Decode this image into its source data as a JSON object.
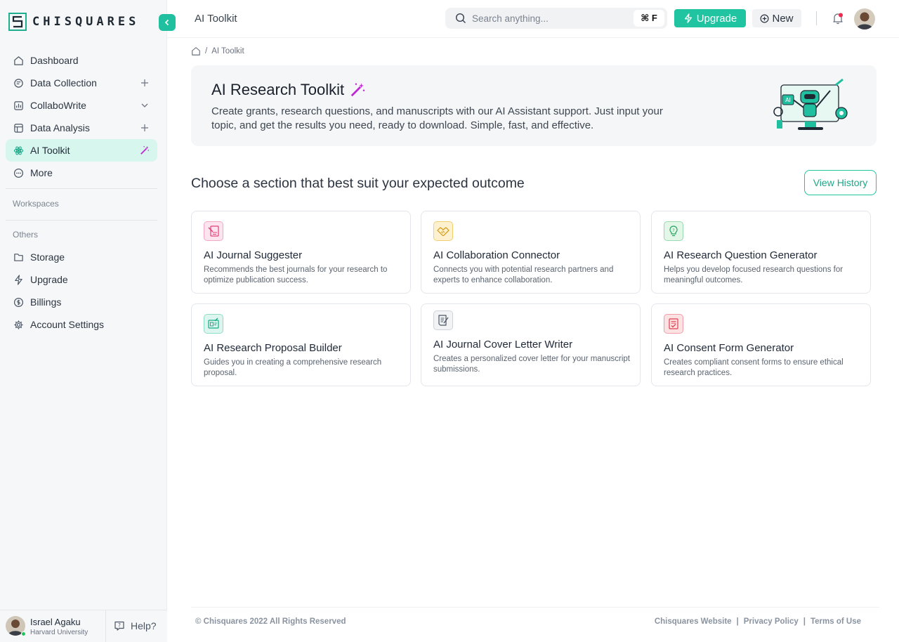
{
  "brand": {
    "name": "CHISQUARES"
  },
  "header": {
    "title": "AI Toolkit",
    "search_placeholder": "Search anything...",
    "shortcut": "⌘ F",
    "upgrade_label": "Upgrade",
    "new_label": "New"
  },
  "sidebar": {
    "items": [
      {
        "label": "Dashboard",
        "icon": "home-icon"
      },
      {
        "label": "Data Collection",
        "icon": "collection-icon",
        "trail": "plus-icon"
      },
      {
        "label": "CollaboWrite",
        "icon": "chart-doc-icon",
        "trail": "chevron-down-icon"
      },
      {
        "label": "Data Analysis",
        "icon": "analysis-icon",
        "trail": "plus-icon"
      },
      {
        "label": "AI Toolkit",
        "icon": "atom-icon",
        "trail": "magic-wand-icon",
        "active": true
      },
      {
        "label": "More",
        "icon": "more-icon"
      }
    ],
    "workspaces_label": "Workspaces",
    "others_label": "Others",
    "others": [
      {
        "label": "Storage",
        "icon": "folder-icon"
      },
      {
        "label": "Upgrade",
        "icon": "bolt-icon"
      },
      {
        "label": "Billings",
        "icon": "billing-icon"
      },
      {
        "label": "Account Settings",
        "icon": "gear-icon"
      }
    ]
  },
  "breadcrumb": {
    "current": "AI Toolkit"
  },
  "banner": {
    "title": "AI Research Toolkit",
    "description": "Create grants, research questions, and manuscripts with our AI Assistant support. Just input your topic, and get the results you need, ready to download. Simple, fast, and effective."
  },
  "main": {
    "choose_title": "Choose a section that best suit your expected outcome",
    "view_history_label": "View History",
    "cards": [
      {
        "title": "AI Journal Suggester",
        "description": "Recommends the best journals for your research to optimize publication success.",
        "icon": "journal-icon",
        "color": "#e0407a"
      },
      {
        "title": "AI Collaboration Connector",
        "description": "Connects you with potential research partners and experts to enhance collaboration.",
        "icon": "handshake-icon",
        "color": "#e6a817"
      },
      {
        "title": "AI Research Question Generator",
        "description": "Helps you develop focused research questions for meaningful outcomes.",
        "icon": "lightbulb-icon",
        "color": "#22a35a"
      },
      {
        "title": "AI Research Proposal Builder",
        "description": "Guides you in creating a comprehensive research proposal.",
        "icon": "proposal-icon",
        "color": "#17a988"
      },
      {
        "title": "AI Journal Cover Letter Writer",
        "description": "Creates a personalized cover letter for your manuscript submissions.",
        "icon": "letter-icon",
        "color": "#5b6470"
      },
      {
        "title": "AI Consent Form Generator",
        "description": "Creates compliant consent forms to ensure ethical research practices.",
        "icon": "consent-icon",
        "color": "#e04050"
      }
    ]
  },
  "footer": {
    "copyright": "© Chisquares 2022  All Rights Reserved",
    "links": [
      "Chisquares Website",
      "Privacy Policy",
      "Terms of Use"
    ]
  },
  "user": {
    "name": "Israel Agaku",
    "org": "Harvard University",
    "help_label": "Help?"
  },
  "colors": {
    "accent": "#20c4a1",
    "active_bg": "#d7f6ee",
    "wand": "#c026d3"
  }
}
